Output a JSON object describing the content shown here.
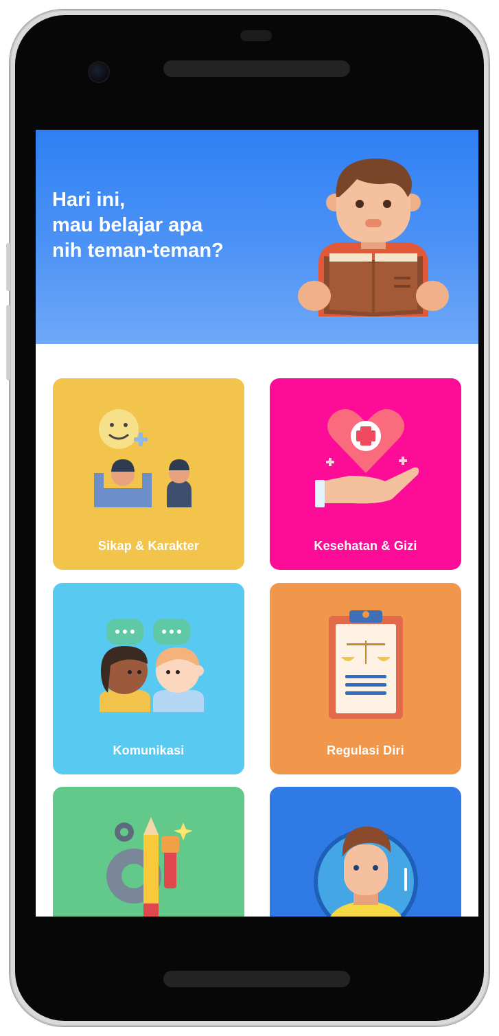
{
  "hero": {
    "lines": [
      "Hari ini,",
      "mau belajar apa",
      "nih teman-teman?"
    ]
  },
  "categories": [
    {
      "label": "Sikap & Karakter",
      "color": "#f2c44b",
      "icon": "smiley-people-icon"
    },
    {
      "label": "Kesehatan & Gizi",
      "color": "#fd0c97",
      "icon": "heart-hand-icon"
    },
    {
      "label": "Komunikasi",
      "color": "#58c9f1",
      "icon": "chat-people-icon"
    },
    {
      "label": "Regulasi Diri",
      "color": "#f0974b",
      "icon": "clipboard-scale-icon"
    },
    {
      "label": "",
      "color": "#63c98a",
      "icon": "pencil-gear-icon"
    },
    {
      "label": "",
      "color": "#2f7ae4",
      "icon": "boy-avatar-icon"
    }
  ]
}
